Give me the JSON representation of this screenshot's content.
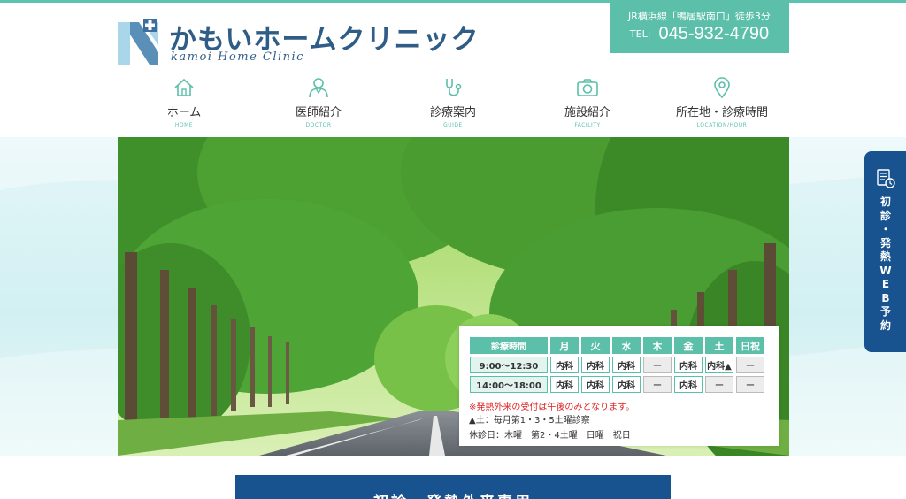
{
  "header": {
    "logo_title": "かもいホームクリニック",
    "logo_subtitle": "kamoi Home Clinic",
    "access": "JR横浜線「鴨居駅南口」徒歩3分",
    "tel_label": "TEL:",
    "tel_number": "045-932-4790"
  },
  "nav": {
    "items": [
      {
        "label": "ホーム",
        "sub": "HOME",
        "icon": "home-icon"
      },
      {
        "label": "医師紹介",
        "sub": "DOCTOR",
        "icon": "doctor-icon"
      },
      {
        "label": "診療案内",
        "sub": "GUIDE",
        "icon": "stethoscope-icon"
      },
      {
        "label": "施設紹介",
        "sub": "FACILITY",
        "icon": "camera-icon"
      },
      {
        "label": "所在地・診療時間",
        "sub": "LOCATION/HOUR",
        "icon": "location-pin-icon"
      }
    ]
  },
  "schedule": {
    "header_label": "診療時間",
    "days": [
      "月",
      "火",
      "水",
      "木",
      "金",
      "土",
      "日祝"
    ],
    "rows": [
      {
        "time": "9:00〜12:30",
        "cells": [
          "内科",
          "内科",
          "内科",
          "ー",
          "内科",
          "内科▲",
          "ー"
        ]
      },
      {
        "time": "14:00〜18:00",
        "cells": [
          "内科",
          "内科",
          "内科",
          "ー",
          "内科",
          "ー",
          "ー"
        ]
      }
    ],
    "note_red": "※発熱外来の受付は午後のみとなります。",
    "note_saturday": "▲土：毎月第1・3・5土曜診察",
    "note_holiday": "休診日：木曜　第2・4土曜　日曜　祝日"
  },
  "side_tab": {
    "chars": [
      "初",
      "診",
      "・",
      "発",
      "熱",
      "W",
      "E",
      "B",
      "予",
      "約"
    ],
    "icon": "web-reservation-icon"
  },
  "bottom_banner": {
    "text": "初診・発熱外来専用"
  },
  "colors": {
    "accent": "#5cbfaa",
    "navy": "#18538f",
    "logo_text": "#2f5d86",
    "red_note": "#e02020"
  }
}
